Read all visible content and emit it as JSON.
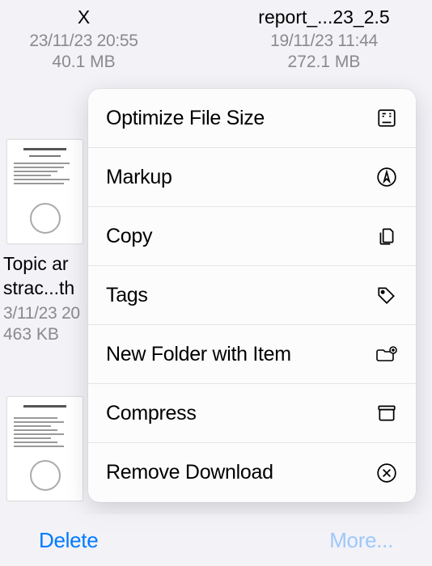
{
  "files": {
    "left": {
      "name": "X",
      "date": "23/11/23 20:55",
      "size": "40.1 MB"
    },
    "right": {
      "name": "report_...23_2.5",
      "date": "19/11/23 11:44",
      "size": "272.1 MB"
    },
    "partial1": {
      "name_line1": "Topic ar",
      "name_line2": "strac...th",
      "date": "3/11/23 20",
      "size": "463 KB"
    }
  },
  "menu": {
    "items": [
      {
        "label": "Optimize File Size"
      },
      {
        "label": "Markup"
      },
      {
        "label": "Copy"
      },
      {
        "label": "Tags"
      },
      {
        "label": "New Folder with Item"
      },
      {
        "label": "Compress"
      },
      {
        "label": "Remove Download"
      }
    ]
  },
  "footer": {
    "delete": "Delete",
    "more": "More..."
  }
}
